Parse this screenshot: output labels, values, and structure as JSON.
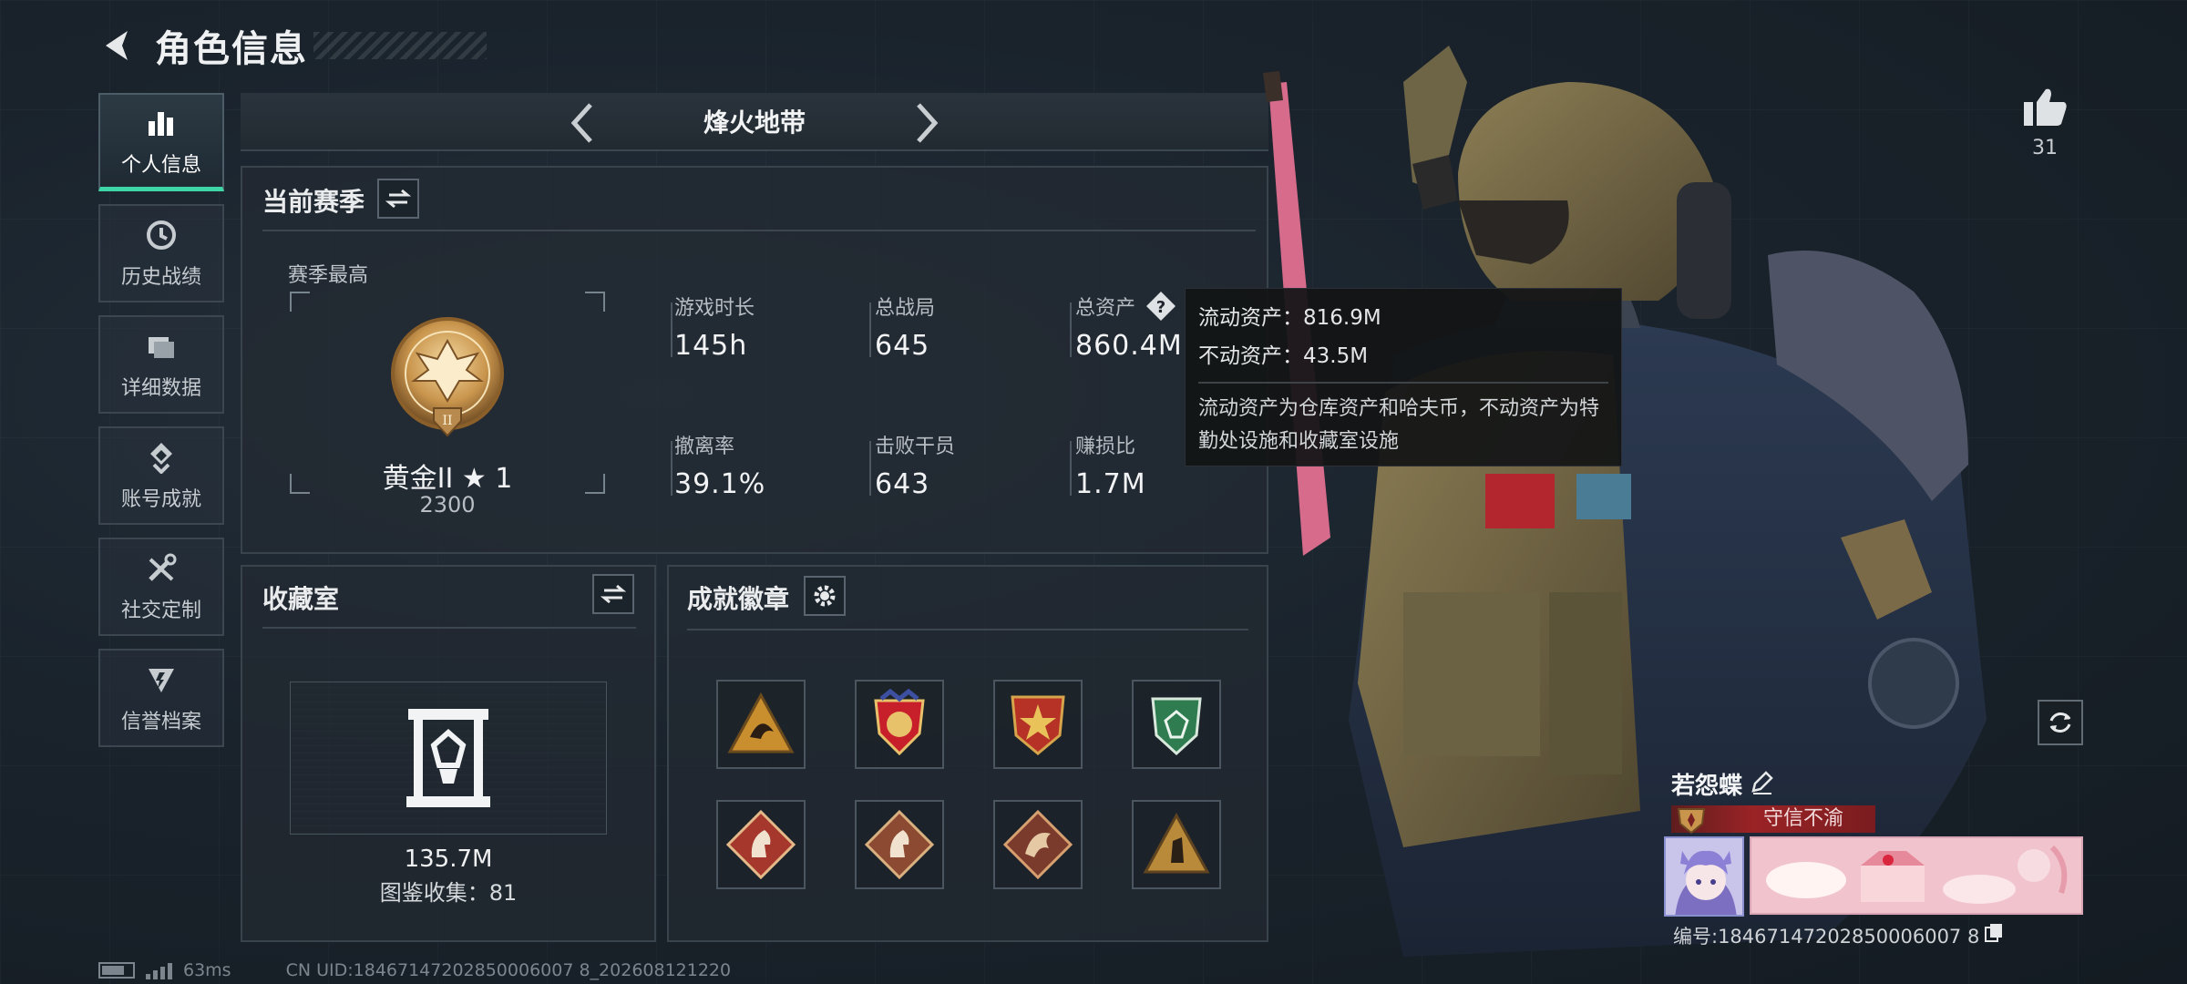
{
  "header": {
    "title": "角色信息"
  },
  "sidebar": {
    "items": [
      {
        "label": "个人信息",
        "icon": "bar-chart-icon",
        "active": true
      },
      {
        "label": "历史战绩",
        "icon": "history-icon"
      },
      {
        "label": "详细数据",
        "icon": "folder-icon"
      },
      {
        "label": "账号成就",
        "icon": "achievement-icon"
      },
      {
        "label": "社交定制",
        "icon": "tools-icon"
      },
      {
        "label": "信誉档案",
        "icon": "credit-shield-icon"
      }
    ]
  },
  "mode": {
    "name": "烽火地带"
  },
  "season": {
    "title": "当前赛季",
    "highest_label": "赛季最高",
    "rank_name": "黄金II ★ 1",
    "rank_score": "2300",
    "stats": [
      {
        "label": "游戏时长",
        "value": "145h"
      },
      {
        "label": "总战局",
        "value": "645"
      },
      {
        "label": "总资产",
        "value": "860.4M"
      },
      {
        "label": "撤离率",
        "value": "39.1%"
      },
      {
        "label": "击败干员",
        "value": "643"
      },
      {
        "label": "赚损比",
        "value": "1.7M"
      }
    ]
  },
  "tooltip": {
    "liquid": "流动资产：816.9M",
    "fixed": "不动资产：43.5M",
    "description": "流动资产为仓库资产和哈夫币，不动资产为特勤处设施和收藏室设施"
  },
  "collection": {
    "title": "收藏室",
    "value": "135.7M",
    "count_text": "图鉴收集：81"
  },
  "badges": {
    "title": "成就徽章",
    "items": [
      "triangle-emblem-gold",
      "shield-emblem-stars",
      "star-shield-emblem",
      "green-shield-emblem",
      "horse-diamond-red",
      "horse-diamond-brown",
      "dragon-diamond",
      "triangle-emblem-soldier"
    ]
  },
  "profile": {
    "likes": "31",
    "player_name": "若怨蝶",
    "title_tag": "守信不渝",
    "player_id": "编号:18467147202850006007 8"
  },
  "footer": {
    "ping": "63ms",
    "uid": "CN UID:18467147202850006007 8_202608121220"
  },
  "colors": {
    "accent": "#3fd6a7",
    "panel": "#222a32",
    "tag_red": "#9a2326"
  }
}
